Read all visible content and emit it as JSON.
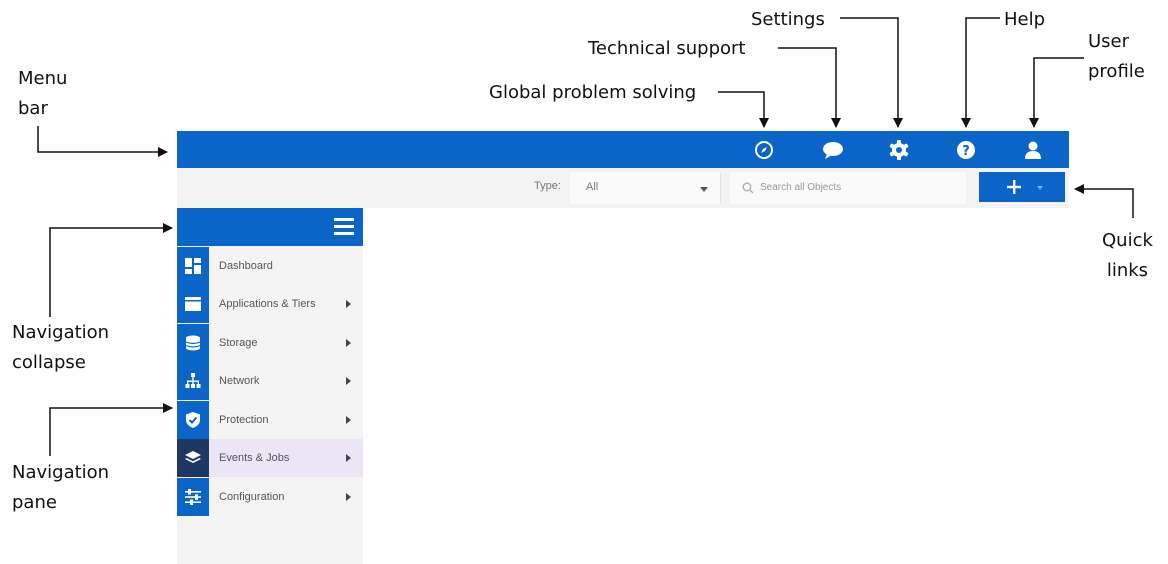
{
  "callouts": {
    "menu_bar": "Menu\nbar",
    "global_problem": "Global problem solving",
    "tech_support": "Technical support",
    "settings": "Settings",
    "help": "Help",
    "user_profile": "User\nprofile",
    "quick_links": "Quick\nlinks",
    "nav_collapse": "Navigation\ncollapse",
    "nav_pane": "Navigation\npane"
  },
  "menubar": {
    "icons": [
      "compass-icon",
      "chat-bubble-icon",
      "gear-icon",
      "help-icon",
      "user-icon"
    ]
  },
  "toolbar": {
    "type_label": "Type:",
    "type_value": "All",
    "search_placeholder": "Search all Objects",
    "quick_links_icon": "plus-icon"
  },
  "nav": {
    "items": [
      {
        "label": "Dashboard",
        "icon": "dashboard-icon",
        "submenu": false
      },
      {
        "label": "Applications & Tiers",
        "icon": "applications-icon",
        "submenu": true
      },
      {
        "label": "Storage",
        "icon": "storage-icon",
        "submenu": true
      },
      {
        "label": "Network",
        "icon": "network-icon",
        "submenu": true
      },
      {
        "label": "Protection",
        "icon": "shield-icon",
        "submenu": true
      },
      {
        "label": "Events & Jobs",
        "icon": "layers-icon",
        "submenu": true,
        "active": true
      },
      {
        "label": "Configuration",
        "icon": "sliders-icon",
        "submenu": true
      }
    ]
  },
  "colors": {
    "brand_blue": "#0b65c8",
    "active_icon_bg": "#1f3763",
    "active_row_bg": "#ece5f6"
  }
}
